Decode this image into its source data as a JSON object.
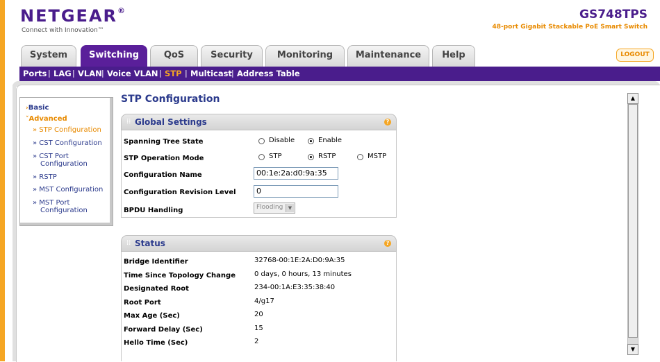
{
  "header": {
    "logo": "NETGEAR",
    "logo_mark": "®",
    "tagline": "Connect with Innovation™",
    "product_name": "GS748TPS",
    "product_desc": "48-port Gigabit Stackable PoE Smart Switch"
  },
  "tabs": [
    {
      "label": "System"
    },
    {
      "label": "Switching"
    },
    {
      "label": "QoS"
    },
    {
      "label": "Security"
    },
    {
      "label": "Monitoring"
    },
    {
      "label": "Maintenance"
    },
    {
      "label": "Help"
    }
  ],
  "logout_label": "LOGOUT",
  "subnav": [
    "Ports",
    "LAG",
    "VLAN",
    "Voice VLAN",
    "STP",
    "Multicast",
    "Address Table"
  ],
  "sidebar": {
    "basic": "Basic",
    "advanced": "Advanced",
    "items": [
      "» STP Configuration",
      "» CST Configuration",
      "» CST Port",
      "Configuration",
      "» RSTP",
      "» MST Configuration",
      "» MST Port",
      "Configuration"
    ]
  },
  "page_title": "STP Configuration",
  "global": {
    "title": "Global Settings",
    "help": "?",
    "spanning_tree_state_label": "Spanning Tree State",
    "disable": "Disable",
    "enable": "Enable",
    "stp_mode_label": "STP Operation Mode",
    "stp": "STP",
    "rstp": "RSTP",
    "mstp": "MSTP",
    "config_name_label": "Configuration Name",
    "config_name_value": "00:1e:2a:d0:9a:35",
    "config_rev_label": "Configuration Revision Level",
    "config_rev_value": "0",
    "bpdu_label": "BPDU Handling",
    "bpdu_value": "Flooding"
  },
  "status": {
    "title": "Status",
    "help": "?",
    "rows": [
      {
        "label": "Bridge Identifier",
        "value": "32768-00:1E:2A:D0:9A:35"
      },
      {
        "label": "Time Since Topology Change",
        "value": "0 days, 0 hours, 13 minutes"
      },
      {
        "label": "Designated Root",
        "value": "234-00:1A:E3:35:38:40"
      },
      {
        "label": "Root Port",
        "value": "4/g17"
      },
      {
        "label": "Max Age (Sec)",
        "value": "20"
      },
      {
        "label": "Forward Delay (Sec)",
        "value": "15"
      },
      {
        "label": "Hello Time (Sec)",
        "value": "2"
      }
    ]
  },
  "colors": {
    "brand": "#4a1d8c",
    "accent": "#f5a623"
  }
}
